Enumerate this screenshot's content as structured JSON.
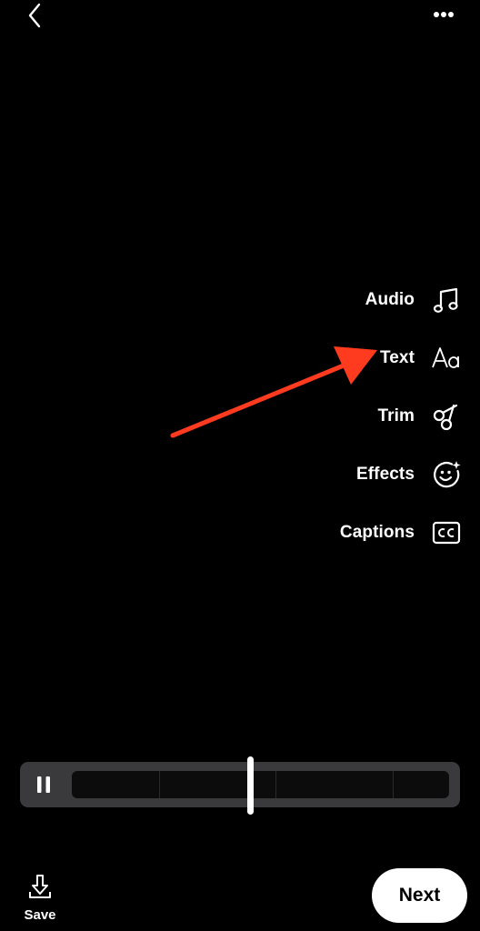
{
  "header": {
    "back_icon": "chevron-left-icon",
    "more_icon": "more-horizontal-icon"
  },
  "tools": [
    {
      "label": "Audio",
      "icon": "music-note-icon"
    },
    {
      "label": "Text",
      "icon": "text-aa-icon"
    },
    {
      "label": "Trim",
      "icon": "scissors-icon"
    },
    {
      "label": "Effects",
      "icon": "sparkle-face-icon"
    },
    {
      "label": "Captions",
      "icon": "cc-icon"
    }
  ],
  "annotation": {
    "color": "#ff3b1f",
    "points_to": "Text"
  },
  "timeline": {
    "pause_icon": "pause-icon"
  },
  "footer": {
    "save_label": "Save",
    "next_label": "Next"
  }
}
